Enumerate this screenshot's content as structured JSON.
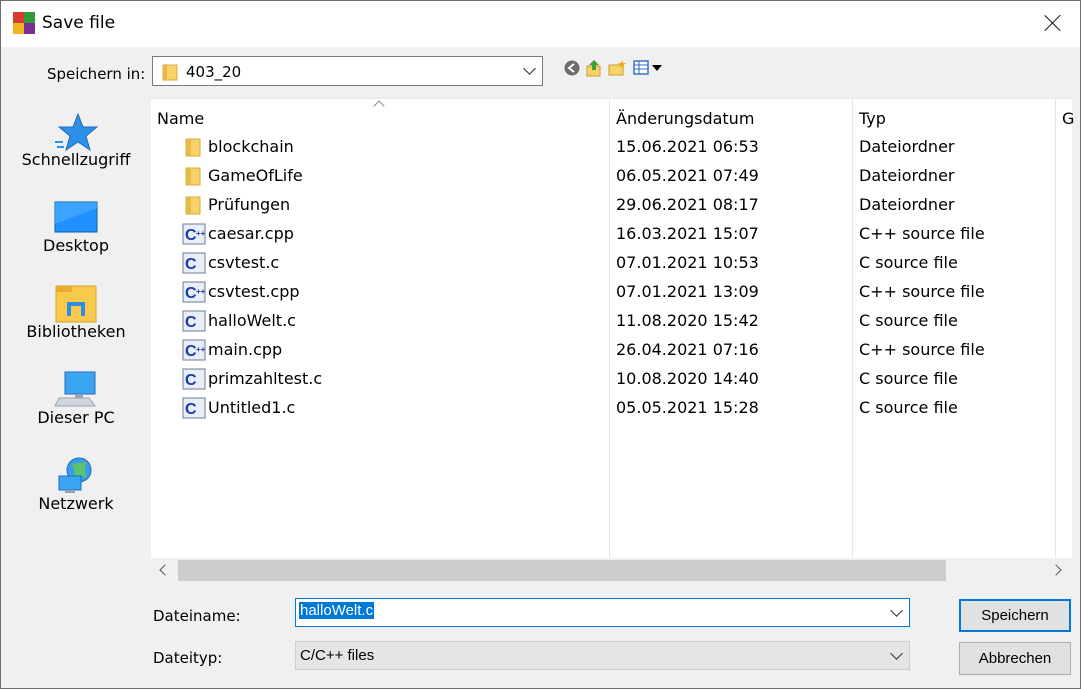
{
  "window": {
    "title": "Save file"
  },
  "lookin": {
    "label": "Speichern in:",
    "value": "403_20"
  },
  "toolbar": {
    "icons": [
      "back-icon",
      "up-folder-icon",
      "new-folder-icon",
      "view-menu-icon"
    ]
  },
  "places": [
    {
      "label": "Schnellzugriff",
      "icon": "star-icon"
    },
    {
      "label": "Desktop",
      "icon": "desktop-icon"
    },
    {
      "label": "Bibliotheken",
      "icon": "library-icon"
    },
    {
      "label": "Dieser PC",
      "icon": "computer-icon"
    },
    {
      "label": "Netzwerk",
      "icon": "network-icon"
    }
  ],
  "columns": {
    "name": "Name",
    "date": "Änderungsdatum",
    "type": "Typ",
    "size": "G"
  },
  "files": [
    {
      "name": "blockchain",
      "date": "15.06.2021 06:53",
      "type": "Dateiordner",
      "kind": "folder"
    },
    {
      "name": "GameOfLife",
      "date": "06.05.2021 07:49",
      "type": "Dateiordner",
      "kind": "folder"
    },
    {
      "name": "Prüfungen",
      "date": "29.06.2021 08:17",
      "type": "Dateiordner",
      "kind": "folder"
    },
    {
      "name": "caesar.cpp",
      "date": "16.03.2021 15:07",
      "type": "C++ source file",
      "kind": "cpp"
    },
    {
      "name": "csvtest.c",
      "date": "07.01.2021 10:53",
      "type": "C source file",
      "kind": "c"
    },
    {
      "name": "csvtest.cpp",
      "date": "07.01.2021 13:09",
      "type": "C++ source file",
      "kind": "cpp"
    },
    {
      "name": "halloWelt.c",
      "date": "11.08.2020 15:42",
      "type": "C source file",
      "kind": "c"
    },
    {
      "name": "main.cpp",
      "date": "26.04.2021 07:16",
      "type": "C++ source file",
      "kind": "cpp"
    },
    {
      "name": "primzahltest.c",
      "date": "10.08.2020 14:40",
      "type": "C source file",
      "kind": "c"
    },
    {
      "name": "Untitled1.c",
      "date": "05.05.2021 15:28",
      "type": "C source file",
      "kind": "c"
    }
  ],
  "form": {
    "filename_label": "Dateiname:",
    "filename_value": "halloWelt.c",
    "filetype_label": "Dateityp:",
    "filetype_value": "C/C++ files"
  },
  "buttons": {
    "save": "Speichern",
    "cancel": "Abbrechen"
  },
  "colors": {
    "accent": "#0078d7",
    "folder": "#f8d36a"
  }
}
